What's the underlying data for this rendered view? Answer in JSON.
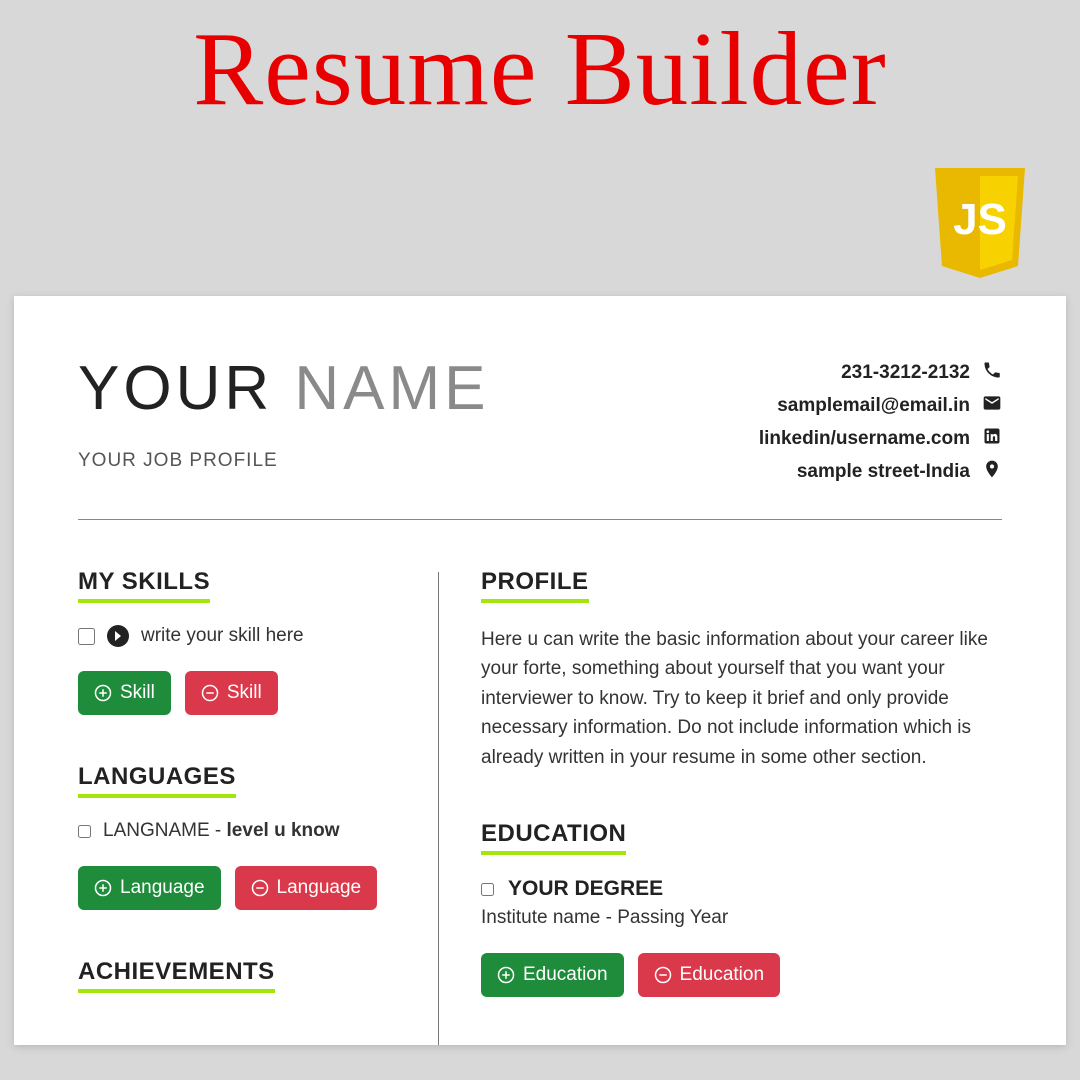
{
  "page": {
    "title": "Resume Builder"
  },
  "js_badge": {
    "label": "JS"
  },
  "header": {
    "first_name": "YOUR",
    "last_name": "NAME",
    "job_profile": "YOUR JOB PROFILE"
  },
  "contact": {
    "phone": "231-3212-2132",
    "email": "samplemail@email.in",
    "linkedin": "linkedin/username.com",
    "address": "sample street-India"
  },
  "sections": {
    "skills": {
      "title": "MY SKILLS",
      "placeholder": "write your skill here",
      "add_label": "Skill",
      "remove_label": "Skill"
    },
    "languages": {
      "title": "LANGUAGES",
      "name_label": "LANGNAME",
      "separator": " - ",
      "level_label": "level u know",
      "add_label": "Language",
      "remove_label": "Language"
    },
    "achievements": {
      "title": "ACHIEVEMENTS"
    },
    "profile": {
      "title": "PROFILE",
      "text": "Here u can write the basic information about your career like your forte, something about yourself that you want your interviewer to know. Try to keep it brief and only provide necessary information. Do not include information which is already written in your resume in some other section."
    },
    "education": {
      "title": "EDUCATION",
      "degree": "YOUR DEGREE",
      "sub": "Institute name - Passing Year",
      "add_label": "Education",
      "remove_label": "Education"
    }
  }
}
